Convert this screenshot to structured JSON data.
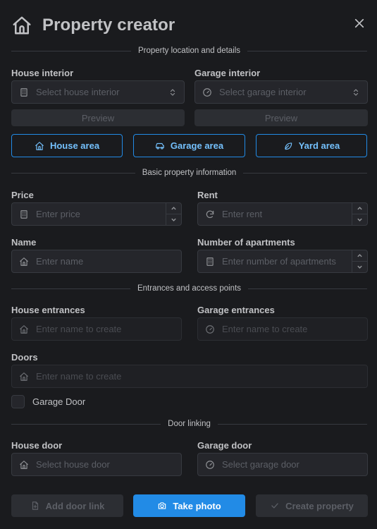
{
  "header": {
    "title": "Property creator"
  },
  "sections": {
    "location": "Property location and details",
    "basic": "Basic property information",
    "entrances": "Entrances and access points",
    "linking": "Door linking"
  },
  "interior": {
    "house_label": "House interior",
    "house_placeholder": "Select house interior",
    "garage_label": "Garage interior",
    "garage_placeholder": "Select garage interior",
    "preview": "Preview"
  },
  "areas": {
    "house": "House area",
    "garage": "Garage area",
    "yard": "Yard area"
  },
  "basic": {
    "price_label": "Price",
    "price_placeholder": "Enter price",
    "rent_label": "Rent",
    "rent_placeholder": "Enter rent",
    "name_label": "Name",
    "name_placeholder": "Enter name",
    "apartments_label": "Number of apartments",
    "apartments_placeholder": "Enter number of apartments"
  },
  "entrances": {
    "house_label": "House entrances",
    "garage_label": "Garage entrances",
    "doors_label": "Doors",
    "create_placeholder": "Enter name to create",
    "garage_door_label": "Garage Door"
  },
  "linking": {
    "house_door_label": "House door",
    "house_door_placeholder": "Select house door",
    "garage_door_label": "Garage door",
    "garage_door_placeholder": "Select garage door"
  },
  "footer": {
    "add_link": "Add door link",
    "take_photo": "Take photo",
    "create": "Create property"
  },
  "colors": {
    "background": "#1a1b1e",
    "accent": "#228be6",
    "accent_text": "#74c0fc"
  }
}
